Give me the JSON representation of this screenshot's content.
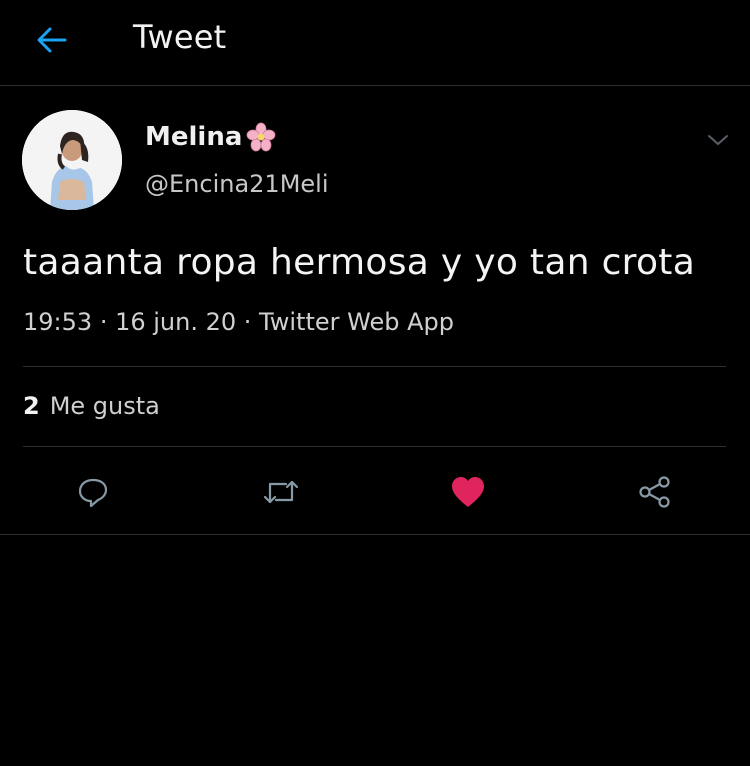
{
  "header": {
    "title": "Tweet",
    "back_icon": "arrow-left-icon"
  },
  "tweet": {
    "author_name": "Melina",
    "author_handle": "@Encina21Meli",
    "text": "taaanta ropa hermosa y yo tan crota",
    "time": "19:53",
    "date": "16 jun. 20",
    "source": "Twitter Web App",
    "likes_count": "2",
    "likes_label": "Me gusta"
  },
  "actions": [
    "reply-icon",
    "retweet-icon",
    "like-icon",
    "share-icon"
  ],
  "colors": {
    "background": "#000000",
    "accent": "#1da1f2",
    "like": "#e0245e",
    "divider": "#2a2d31",
    "text": "#f2f2f2",
    "muted": "#8899a6"
  }
}
